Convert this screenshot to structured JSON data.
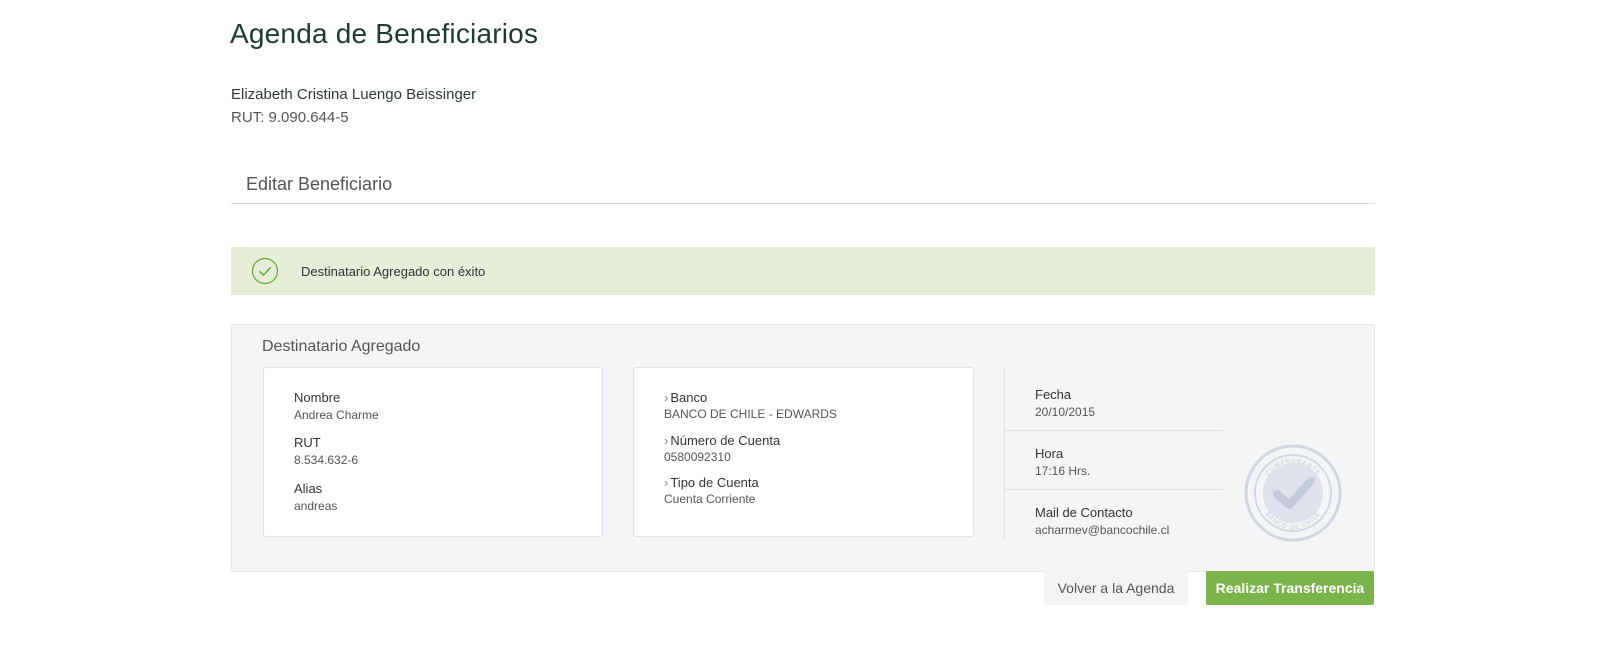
{
  "page": {
    "title": "Agenda de Beneficiarios",
    "user_name": "Elizabeth Cristina Luengo Beissinger",
    "user_rut": "RUT: 9.090.644-5"
  },
  "section": {
    "title": "Editar Beneficiario"
  },
  "alert": {
    "message": "Destinatario Agregado con éxito",
    "icon": "check-circle-icon",
    "background": "#e5efd7",
    "accent": "#6aa441"
  },
  "panel": {
    "title": "Destinatario Agregado",
    "beneficiary": {
      "name_label": "Nombre",
      "name_value": "Andrea Charme",
      "rut_label": "RUT",
      "rut_value": "8.534.632-6",
      "alias_label": "Alias",
      "alias_value": "andreas"
    },
    "account": {
      "bank_label": "Banco",
      "bank_value": "BANCO DE CHILE - EDWARDS",
      "number_label": "Número de Cuenta",
      "number_value": "0580092310",
      "type_label": "Tipo de Cuenta",
      "type_value": "Cuenta Corriente"
    },
    "info": {
      "date_label": "Fecha",
      "date_value": "20/10/2015",
      "time_label": "Hora",
      "time_value": "17:16 Hrs.",
      "mail_label": "Mail de Contacto",
      "mail_value": "acharmev@bancochile.cl"
    },
    "seal": {
      "icon": "comprobante-seal-icon",
      "top_text": "COMPROBANTE",
      "bottom_text": "BANCO DE CHILE"
    }
  },
  "buttons": {
    "back_label": "Volver a la Agenda",
    "transfer_label": "Realizar Transferencia",
    "primary_color": "#7ab44a"
  }
}
